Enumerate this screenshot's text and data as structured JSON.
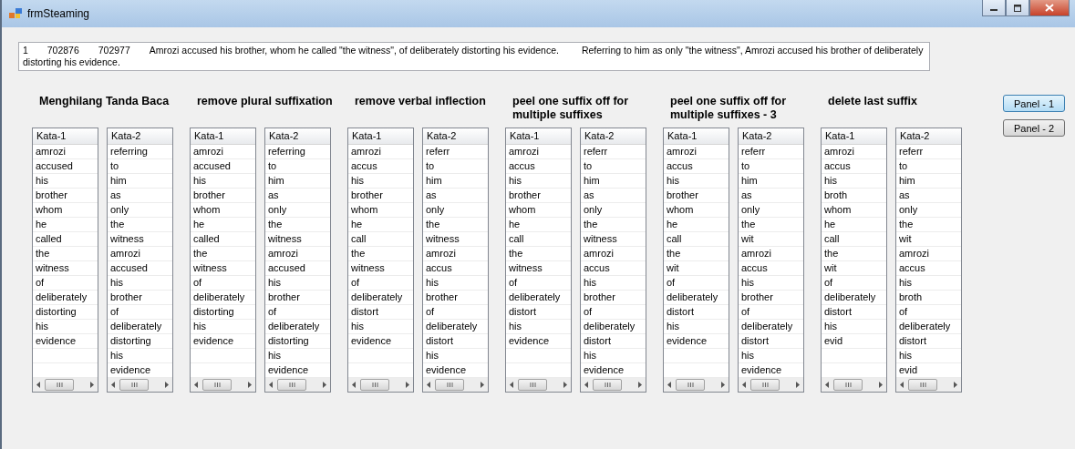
{
  "window": {
    "title": "frmSteaming"
  },
  "record": {
    "number": "1",
    "id_1": "702876",
    "id_2": "702977",
    "sentence_1": "Amrozi accused his brother, whom he called \"the witness\", of deliberately distorting his evidence.",
    "sentence_2": "Referring to him as only \"the witness\", Amrozi accused his brother of deliberately distorting his evidence."
  },
  "groups": [
    {
      "title": "Menghilang Tanda Baca",
      "lists": [
        {
          "header": "Kata-1",
          "rows": [
            "amrozi",
            "accused",
            "his",
            "brother",
            "whom",
            "he",
            "called",
            "the",
            "witness",
            "of",
            "deliberately",
            "distorting",
            "his",
            "evidence"
          ]
        },
        {
          "header": "Kata-2",
          "rows": [
            "referring",
            "to",
            "him",
            "as",
            "only",
            "the",
            "witness",
            "amrozi",
            "accused",
            "his",
            "brother",
            "of",
            "deliberately",
            "distorting",
            "his",
            "evidence"
          ]
        }
      ]
    },
    {
      "title": "remove plural suffixation",
      "lists": [
        {
          "header": "Kata-1",
          "rows": [
            "amrozi",
            "accused",
            "his",
            "brother",
            "whom",
            "he",
            "called",
            "the",
            "witness",
            "of",
            "deliberately",
            "distorting",
            "his",
            "evidence"
          ]
        },
        {
          "header": "Kata-2",
          "rows": [
            "referring",
            "to",
            "him",
            "as",
            "only",
            "the",
            "witness",
            "amrozi",
            "accused",
            "his",
            "brother",
            "of",
            "deliberately",
            "distorting",
            "his",
            "evidence"
          ]
        }
      ]
    },
    {
      "title": "remove verbal inflection",
      "lists": [
        {
          "header": "Kata-1",
          "rows": [
            "amrozi",
            "accus",
            "his",
            "brother",
            "whom",
            "he",
            "call",
            "the",
            "witness",
            "of",
            "deliberately",
            "distort",
            "his",
            "evidence"
          ]
        },
        {
          "header": "Kata-2",
          "rows": [
            "referr",
            "to",
            "him",
            "as",
            "only",
            "the",
            "witness",
            "amrozi",
            "accus",
            "his",
            "brother",
            "of",
            "deliberately",
            "distort",
            "his",
            "evidence"
          ]
        }
      ]
    },
    {
      "title": "peel one suffix off for multiple suffixes",
      "lists": [
        {
          "header": "Kata-1",
          "rows": [
            "amrozi",
            "accus",
            "his",
            "brother",
            "whom",
            "he",
            "call",
            "the",
            "witness",
            "of",
            "deliberately",
            "distort",
            "his",
            "evidence"
          ]
        },
        {
          "header": "Kata-2",
          "rows": [
            "referr",
            "to",
            "him",
            "as",
            "only",
            "the",
            "witness",
            "amrozi",
            "accus",
            "his",
            "brother",
            "of",
            "deliberately",
            "distort",
            "his",
            "evidence"
          ]
        }
      ]
    },
    {
      "title": "peel one suffix off for multiple suffixes - 3",
      "lists": [
        {
          "header": "Kata-1",
          "rows": [
            "amrozi",
            "accus",
            "his",
            "brother",
            "whom",
            "he",
            "call",
            "the",
            "wit",
            "of",
            "deliberately",
            "distort",
            "his",
            "evidence"
          ]
        },
        {
          "header": "Kata-2",
          "rows": [
            "referr",
            "to",
            "him",
            "as",
            "only",
            "the",
            "wit",
            "amrozi",
            "accus",
            "his",
            "brother",
            "of",
            "deliberately",
            "distort",
            "his",
            "evidence"
          ]
        }
      ]
    },
    {
      "title": "delete last suffix",
      "lists": [
        {
          "header": "Kata-1",
          "rows": [
            "amrozi",
            "accus",
            "his",
            "broth",
            "whom",
            "he",
            "call",
            "the",
            "wit",
            "of",
            "deliberately",
            "distort",
            "his",
            "evid"
          ]
        },
        {
          "header": "Kata-2",
          "rows": [
            "referr",
            "to",
            "him",
            "as",
            "only",
            "the",
            "wit",
            "amrozi",
            "accus",
            "his",
            "broth",
            "of",
            "deliberately",
            "distort",
            "his",
            "evid"
          ]
        }
      ]
    }
  ],
  "panel_buttons": [
    {
      "label": "Panel - 1",
      "selected": true
    },
    {
      "label": "Panel - 2",
      "selected": false
    }
  ]
}
